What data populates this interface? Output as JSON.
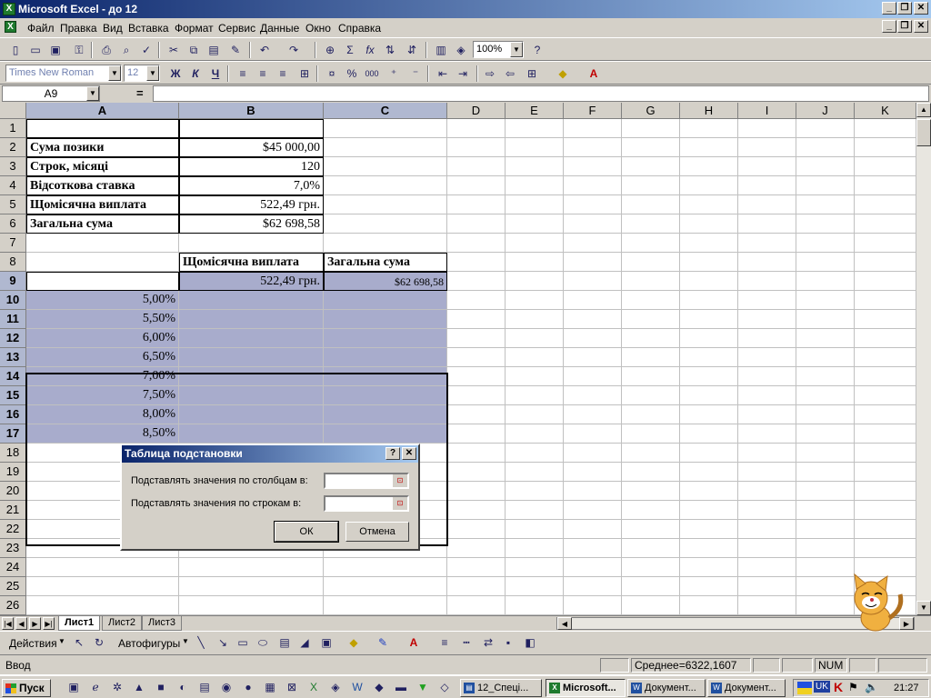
{
  "window": {
    "title": "Microsoft Excel - до 12",
    "icon": "excel-icon"
  },
  "menu": [
    "Файл",
    "Правка",
    "Вид",
    "Вставка",
    "Формат",
    "Сервис",
    "Данные",
    "Окно",
    "Справка"
  ],
  "toolbar": {
    "zoom": "100%",
    "font_name": "Times New Roman",
    "font_size": "12",
    "bold": "Ж",
    "italic": "К",
    "underline": "Ч",
    "percent": "%",
    "thousands": "000"
  },
  "formula_bar": {
    "name_box": "A9",
    "equals": "=",
    "value": ""
  },
  "columns": [
    "A",
    "B",
    "C",
    "D",
    "E",
    "F",
    "G",
    "H",
    "I",
    "J",
    "K"
  ],
  "rows": [
    "1",
    "2",
    "3",
    "4",
    "5",
    "6",
    "7",
    "8",
    "9",
    "10",
    "11",
    "12",
    "13",
    "14",
    "15",
    "16",
    "17",
    "18",
    "19",
    "20",
    "21",
    "22",
    "23",
    "24",
    "25",
    "26"
  ],
  "cells": {
    "A2": "Сума позики",
    "B2": "$45 000,00",
    "A3": "Строк, місяці",
    "B3": "120",
    "A4": "Відсоткова ставка",
    "B4": "7,0%",
    "A5": "Щомісячна виплата",
    "B5": "522,49 грн.",
    "A6": "Загальна сума",
    "B6": "$62 698,58",
    "B8": "Щомісячна виплата",
    "C8": "Загальна сума",
    "B9": "522,49 грн.",
    "C9": "$62 698,58",
    "A10": "5,00%",
    "A11": "5,50%",
    "A12": "6,00%",
    "A13": "6,50%",
    "A14": "7,00%",
    "A15": "7,50%",
    "A16": "8,00%",
    "A17": "8,50%"
  },
  "sheet_tabs": [
    "Лист1",
    "Лист2",
    "Лист3"
  ],
  "drawing": {
    "actions": "Действия",
    "autoshapes": "Автофигуры"
  },
  "status": {
    "mode": "Ввод",
    "average": "Среднее=6322,1607",
    "num": "NUM"
  },
  "dialog": {
    "title": "Таблица подстановки",
    "help": "?",
    "close": "✕",
    "col_label": "Подставлять значения по столбцам в:",
    "row_label": "Подставлять значения по строкам в:",
    "col_value": "",
    "row_value": "",
    "ok": "ОК",
    "cancel": "Отмена"
  },
  "taskbar": {
    "start": "Пуск",
    "tasks": [
      "12_Спеці...",
      "Microsoft...",
      "Документ...",
      "Документ..."
    ],
    "lang": "UK",
    "clock": "21:27"
  }
}
